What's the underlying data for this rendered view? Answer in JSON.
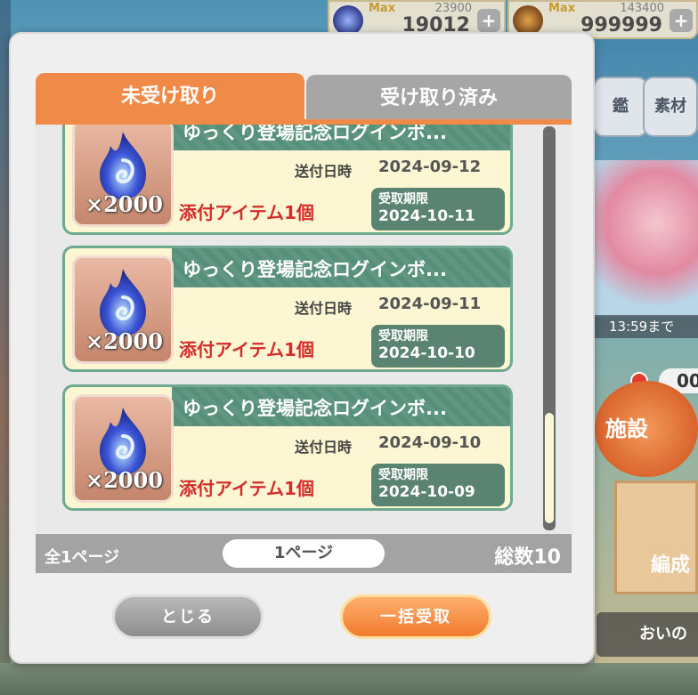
{
  "resources": [
    {
      "max_label": "Max",
      "cap": "23900",
      "value": "19012",
      "plus": "+",
      "icon": "blue-flame-icon"
    },
    {
      "max_label": "Max",
      "cap": "143400",
      "value": "999999",
      "plus": "+",
      "icon": "bear-coin-icon"
    }
  ],
  "side": {
    "btn1": "鑑",
    "btn2": "素材",
    "timer": "13:59まで",
    "counter": "00",
    "facility": "施設",
    "formation": "編成",
    "bottom_tab": "おいの"
  },
  "tabs": {
    "active": "未受け取り",
    "inactive": "受け取り済み"
  },
  "items": [
    {
      "title": "ゆっくり登場記念ログインボ...",
      "qty": "×2000",
      "sent_label": "送付日時",
      "sent_date": "2024-09-12",
      "attach": "添付アイテム1個",
      "deadline_label": "受取期限",
      "deadline_date": "2024-10-11"
    },
    {
      "title": "ゆっくり登場記念ログインボ...",
      "qty": "×2000",
      "sent_label": "送付日時",
      "sent_date": "2024-09-11",
      "attach": "添付アイテム1個",
      "deadline_label": "受取期限",
      "deadline_date": "2024-10-10"
    },
    {
      "title": "ゆっくり登場記念ログインボ...",
      "qty": "×2000",
      "sent_label": "送付日時",
      "sent_date": "2024-09-10",
      "attach": "添付アイテム1個",
      "deadline_label": "受取期限",
      "deadline_date": "2024-10-09"
    }
  ],
  "footer": {
    "total_pages": "全1ページ",
    "current_page": "1ページ",
    "total_count": "総数10"
  },
  "buttons": {
    "close": "とじる",
    "claim_all": "一括受取"
  },
  "colors": {
    "tab_active": "#f08a48",
    "card_header": "#56907a",
    "attach_text": "#d42b2b",
    "claim_button": "#f07a2c"
  }
}
